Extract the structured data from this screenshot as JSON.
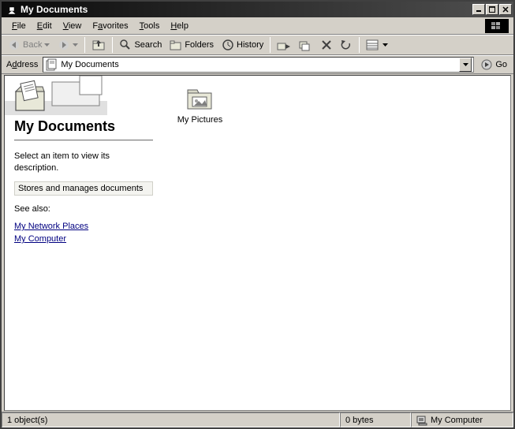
{
  "titlebar": {
    "title": "My Documents"
  },
  "menubar": {
    "file_html": "<u>F</u>ile",
    "edit_html": "<u>E</u>dit",
    "view_html": "<u>V</u>iew",
    "favorites_html": "F<u>a</u>vorites",
    "tools_html": "<u>T</u>ools",
    "help_html": "<u>H</u>elp"
  },
  "toolbar": {
    "back": "Back",
    "search": "Search",
    "folders": "Folders",
    "history": "History"
  },
  "addressbar": {
    "label_html": "A<u>d</u>dress",
    "value": "My Documents",
    "go": "Go"
  },
  "panel": {
    "title": "My Documents",
    "select_prompt": "Select an item to view its description.",
    "description": "Stores and manages documents",
    "see_also": "See also:",
    "link1": "My Network Places",
    "link2": "My Computer"
  },
  "items": [
    {
      "label": "My Pictures"
    }
  ],
  "statusbar": {
    "objects": "1 object(s)",
    "size": "0 bytes",
    "location": "My Computer"
  }
}
